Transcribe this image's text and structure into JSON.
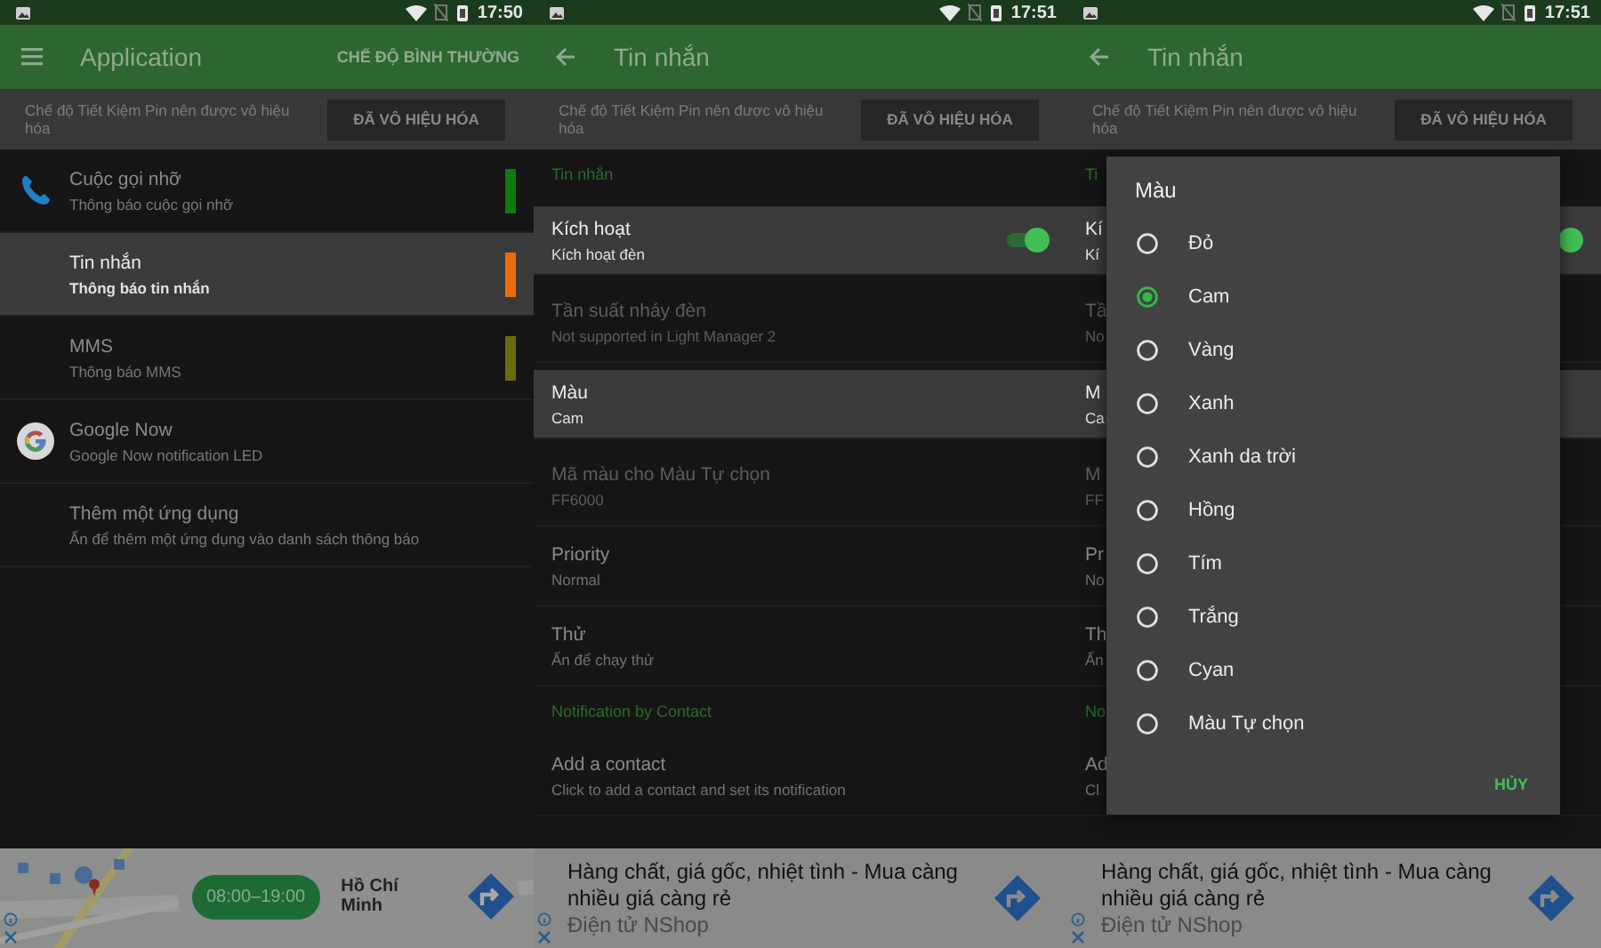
{
  "screens": [
    {
      "status_bar": {
        "time": "17:50"
      },
      "toolbar": {
        "title": "Application",
        "action": "CHẾ ĐỘ BÌNH THƯỜNG"
      },
      "battery_banner": {
        "text": "Chế độ Tiết Kiệm Pin nên được vô hiệu hóa",
        "button": "ĐÃ VÔ HIỆU HÓA"
      },
      "apps": [
        {
          "kind": "phone",
          "title": "Cuộc gọi nhỡ",
          "subtitle": "Thông báo cuộc gọi nhỡ",
          "color": "#0f7a12",
          "selected": false
        },
        {
          "kind": "plain",
          "title": "Tin nhắn",
          "subtitle": "Thông báo tin nhắn",
          "color": "#f06a0c",
          "selected": true
        },
        {
          "kind": "plain",
          "title": "MMS",
          "subtitle": "Thông báo MMS",
          "color": "#6b6b0c",
          "selected": false
        },
        {
          "kind": "google",
          "title": "Google Now",
          "subtitle": "Google Now notification LED",
          "selected": false
        },
        {
          "kind": "plain",
          "title": "Thêm một ứng dụng",
          "subtitle": "Ấn để thêm một ứng dụng vào danh sách thông báo",
          "selected": false
        }
      ],
      "ad": {
        "kind": "map",
        "hours": "08:00–19:00",
        "place": "Hồ Chí Minh"
      }
    },
    {
      "status_bar": {
        "time": "17:51"
      },
      "toolbar": {
        "title": "Tin nhắn"
      },
      "battery_banner": {
        "text": "Chế độ Tiết Kiệm Pin nên được vô hiệu hóa",
        "button": "ĐÃ VÔ HIỆU HÓA"
      },
      "settings": [
        {
          "kind": "header",
          "text": "Tin nhắn"
        },
        {
          "kind": "switch",
          "title": "Kích hoạt",
          "subtitle": "Kích hoạt đèn",
          "on": true,
          "selected": true,
          "disabled": false
        },
        {
          "kind": "item",
          "title": "Tần suất nháy đèn",
          "subtitle": "Not supported in Light Manager 2",
          "selected": false,
          "disabled": true
        },
        {
          "kind": "item",
          "title": "Màu",
          "subtitle": "Cam",
          "selected": true,
          "disabled": false
        },
        {
          "kind": "item",
          "title": "Mã màu cho Màu Tự chọn",
          "subtitle": "FF6000",
          "selected": false,
          "disabled": true
        },
        {
          "kind": "item",
          "title": "Priority",
          "subtitle": "Normal",
          "selected": false,
          "disabled": false
        },
        {
          "kind": "item",
          "title": "Thử",
          "subtitle": "Ấn để chạy thử",
          "selected": false,
          "disabled": false
        },
        {
          "kind": "header",
          "text": "Notification by Contact"
        },
        {
          "kind": "item",
          "title": "Add a contact",
          "subtitle": "Click to add a contact and set its notification",
          "selected": false,
          "disabled": false
        }
      ],
      "ad": {
        "kind": "text",
        "headline": "Hàng chất, giá gốc, nhiệt tình - Mua càng nhiều giá càng rẻ",
        "source": "Điện tử NShop"
      }
    },
    {
      "status_bar": {
        "time": "17:51"
      },
      "toolbar": {
        "title": "Tin nhắn"
      },
      "battery_banner": {
        "text": "Chế độ Tiết Kiệm Pin nên được vô hiệu hóa",
        "button": "ĐÃ VÔ HIỆU HÓA"
      },
      "settings": [
        {
          "kind": "header",
          "text": "Ti"
        },
        {
          "kind": "switch",
          "title": "Kí",
          "subtitle": "Kí",
          "on": true,
          "selected": true,
          "disabled": false
        },
        {
          "kind": "item",
          "title": "Tầ",
          "subtitle": "No",
          "selected": false,
          "disabled": true
        },
        {
          "kind": "item",
          "title": "M",
          "subtitle": "Ca",
          "selected": true,
          "disabled": false
        },
        {
          "kind": "item",
          "title": "M",
          "subtitle": "FF",
          "selected": false,
          "disabled": true
        },
        {
          "kind": "item",
          "title": "Pr",
          "subtitle": "No",
          "selected": false,
          "disabled": false
        },
        {
          "kind": "item",
          "title": "Th",
          "subtitle": "Ấn",
          "selected": false,
          "disabled": false
        },
        {
          "kind": "header",
          "text": "No"
        },
        {
          "kind": "item",
          "title": "Ad",
          "subtitle": "Cl",
          "selected": false,
          "disabled": false
        }
      ],
      "dialog": {
        "title": "Màu",
        "options": [
          {
            "label": "Đỏ",
            "selected": false
          },
          {
            "label": "Cam",
            "selected": true
          },
          {
            "label": "Vàng",
            "selected": false
          },
          {
            "label": "Xanh",
            "selected": false
          },
          {
            "label": "Xanh da trời",
            "selected": false
          },
          {
            "label": "Hồng",
            "selected": false
          },
          {
            "label": "Tím",
            "selected": false
          },
          {
            "label": "Trắng",
            "selected": false
          },
          {
            "label": "Cyan",
            "selected": false
          },
          {
            "label": "Màu Tự chọn",
            "selected": false
          }
        ],
        "cancel": "HỦY"
      },
      "ad": {
        "kind": "text",
        "headline": "Hàng chất, giá gốc, nhiệt tình - Mua càng nhiều giá càng rẻ",
        "source": "Điện tử NShop"
      }
    }
  ]
}
